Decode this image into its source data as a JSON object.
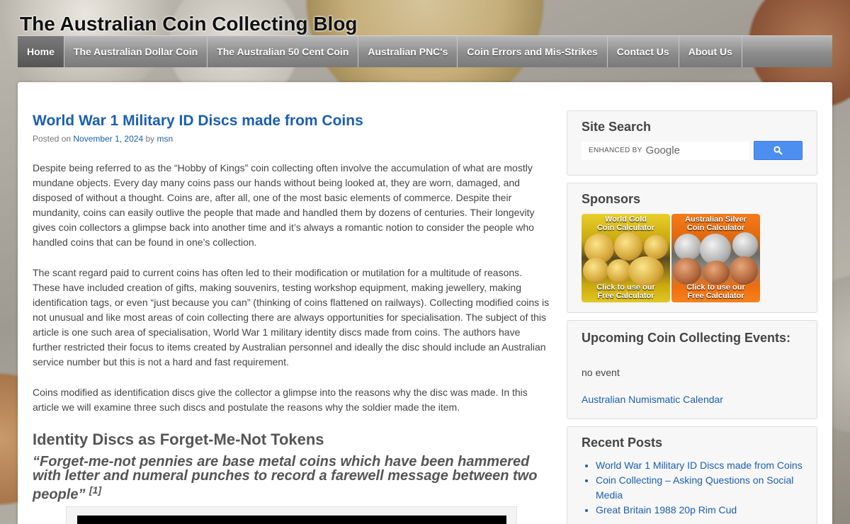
{
  "site": {
    "title": "The Australian Coin Collecting Blog"
  },
  "nav": {
    "items": [
      {
        "label": "Home"
      },
      {
        "label": "The Australian Dollar Coin"
      },
      {
        "label": "The Australian 50 Cent Coin"
      },
      {
        "label": "Australian PNC's"
      },
      {
        "label": "Coin Errors and Mis-Strikes"
      },
      {
        "label": "Contact Us"
      },
      {
        "label": "About Us"
      }
    ]
  },
  "post": {
    "title": "World War 1 Military ID Discs made from Coins",
    "posted_on": "Posted on",
    "date": "November 1, 2024",
    "by": "by",
    "author": "msn",
    "paragraphs": [
      "Despite being referred to as the “Hobby of Kings” coin collecting often involve the accumulation of what are mostly mundane objects.  Every day many coins pass our hands without being looked at, they are worn, damaged, and disposed of without a thought.  Coins are, after all, one of the most basic elements of commerce.  Despite their mundanity, coins can easily outlive the people that made and handled them by dozens of centuries.  Their longevity gives coin collectors a glimpse back into another time and it’s always a romantic notion to consider the people who handled coins that can be found in one’s collection.",
      "The scant regard paid to current coins has often led to their modification or mutilation for a multitude of reasons.  These have included creation of gifts, making souvenirs, testing workshop equipment, making jewellery, making identification tags, or even “just because you can” (thinking of coins flattened on railways).  Collecting modified coins is not unusual and like most areas of coin collecting there are always opportunities for specialisation.  The subject of this article is one such area of specialisation, World War 1 military identity discs made from coins.  The authors have further restricted their focus to items created by Australian personnel and ideally the disc should include an Australian service number but this is not a hard and fast requirement.",
      "Coins modified as identification discs give the collector a glimpse into the reasons why the disc was made.  In this article we will examine three such discs and postulate the reasons why the soldier made the item."
    ],
    "heading": "Identity Discs as Forget-Me-Not Tokens",
    "quote": "“Forget-me-not pennies are base metal coins which have been hammered with letter and numeral punches to record a farewell message between two people”",
    "quote_ref": "[1]"
  },
  "sidebar": {
    "search": {
      "title": "Site Search",
      "enhanced_by": "ENHANCED BY",
      "google": "Google"
    },
    "sponsors": {
      "title": "Sponsors",
      "items": [
        {
          "label_line1": "World Gold",
          "label_line2": "Coin Calculator",
          "cta_line1": "Click to use our",
          "cta_line2": "Free Calculator"
        },
        {
          "label_line1": "Australian Silver",
          "label_line2": "Coin Calculator",
          "cta_line1": "Click to use our",
          "cta_line2": "Free Calculator"
        }
      ]
    },
    "events": {
      "title": "Upcoming Coin Collecting Events:",
      "no_event": "no event",
      "calendar_link": "Australian Numismatic Calendar"
    },
    "recent": {
      "title": "Recent Posts",
      "items": [
        "World War 1 Military ID Discs made from Coins",
        "Coin Collecting – Asking Questions on Social Media",
        "Great Britain 1988 20p Rim Cud"
      ]
    }
  }
}
